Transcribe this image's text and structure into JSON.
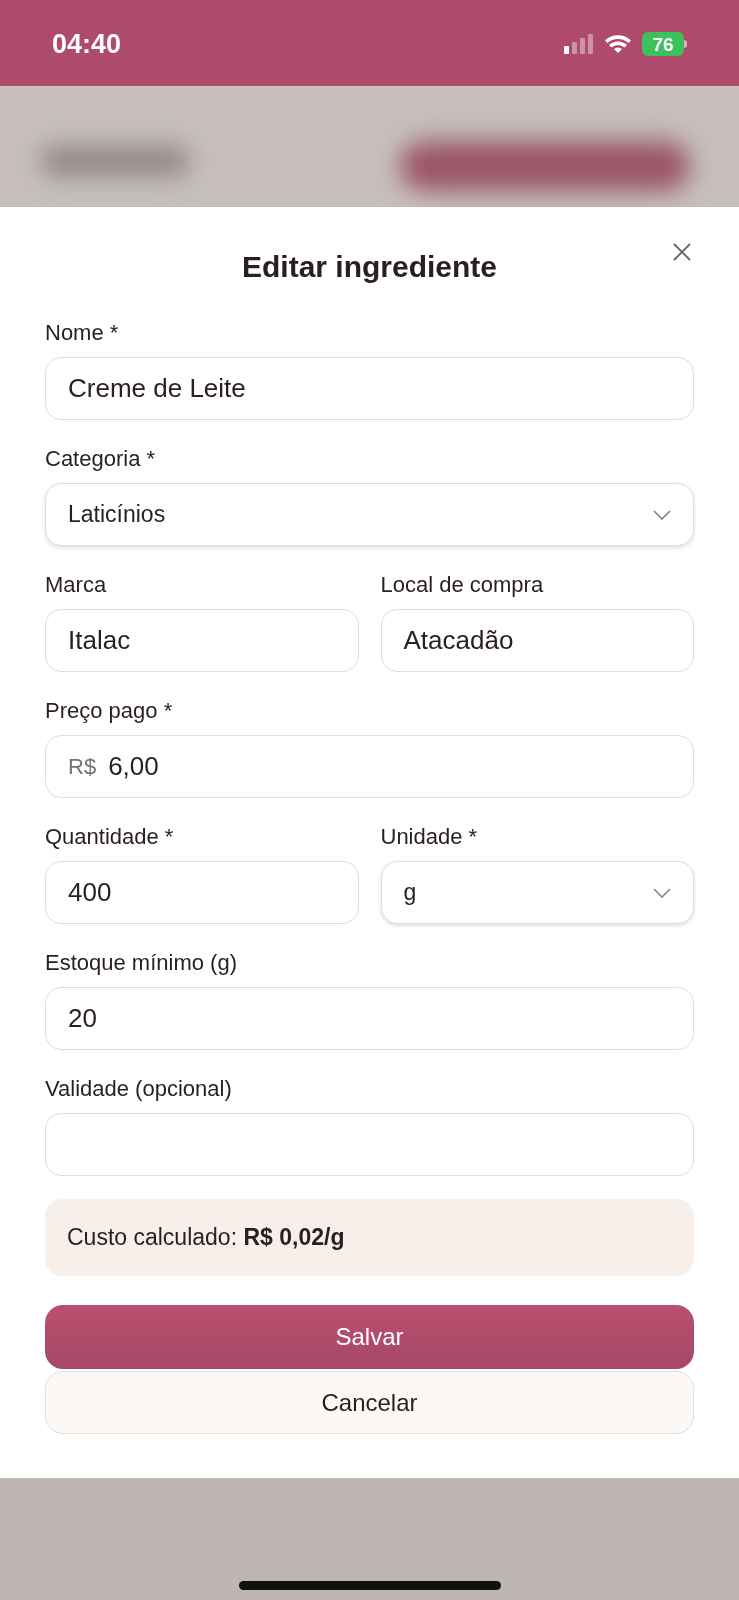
{
  "status_bar": {
    "time": "04:40",
    "battery": "76"
  },
  "dialog": {
    "title": "Editar ingrediente",
    "rows": [
      {
        "fields": [
          {
            "kind": "text",
            "label": "Nome *",
            "value": "Creme de Leite"
          }
        ]
      },
      {
        "fields": [
          {
            "kind": "select",
            "label": "Categoria *",
            "value": "Laticínios"
          }
        ]
      },
      {
        "fields": [
          {
            "kind": "text",
            "label": "Marca",
            "value": "Italac"
          },
          {
            "kind": "text",
            "label": "Local de compra",
            "value": "Atacadão"
          }
        ]
      },
      {
        "fields": [
          {
            "kind": "currency",
            "label": "Preço pago *",
            "prefix": "R$",
            "value": "6,00"
          }
        ]
      },
      {
        "fields": [
          {
            "kind": "text",
            "label": "Quantidade *",
            "value": "400"
          },
          {
            "kind": "select",
            "label": "Unidade *",
            "value": "g"
          }
        ]
      },
      {
        "fields": [
          {
            "kind": "text",
            "label": "Estoque mínimo (g)",
            "value": "20"
          }
        ]
      },
      {
        "fields": [
          {
            "kind": "text",
            "label": "Validade (opcional)"
          }
        ]
      }
    ],
    "summary": "Custo calculado: **R$ 0,02/g**",
    "buttons": [
      {
        "kind": "primary",
        "label": "Salvar"
      },
      {
        "kind": "secondary",
        "label": "Cancelar"
      }
    ]
  }
}
